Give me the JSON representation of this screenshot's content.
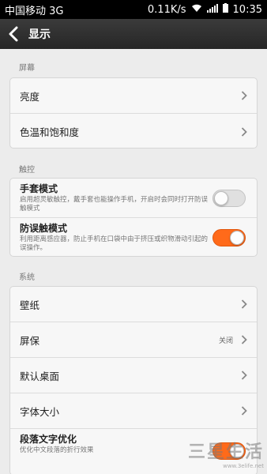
{
  "status_bar": {
    "carrier": "中国移动 3G",
    "speed": "0.11K/s",
    "time": "10:35",
    "wifi_icon": "wifi-icon",
    "signal_icon": "signal-icon",
    "battery_icon": "battery-icon"
  },
  "header": {
    "title": "显示",
    "back_icon": "back-chevron-icon"
  },
  "sections": {
    "screen": "屏幕",
    "touch": "触控",
    "system": "系统"
  },
  "screen_items": {
    "brightness": "亮度",
    "color_temp": "色温和饱和度"
  },
  "touch_items": {
    "glove_title": "手套模式",
    "glove_desc": "启用超灵敏触控，戴手套也能操作手机，开启时会同时打开防误触模式",
    "glove_on": false,
    "pocket_title": "防误触模式",
    "pocket_desc": "利用距离感应器，防止手机在口袋中由于挤压或织物滑动引起的误操作。",
    "pocket_on": true
  },
  "system_items": {
    "wallpaper": "壁纸",
    "screensaver": "屏保",
    "screensaver_value": "关闭",
    "default_launcher": "默认桌面",
    "font_size": "字体大小",
    "paragraph_title": "段落文字优化",
    "paragraph_desc": "优化中文段落的折行效果",
    "paragraph_on": true
  },
  "colors": {
    "accent": "#ff6a1a",
    "header_bg": "#2f2f2f",
    "page_bg": "#ececec"
  },
  "watermark": {
    "main": "三星生活",
    "url": "www.3elife.net"
  }
}
